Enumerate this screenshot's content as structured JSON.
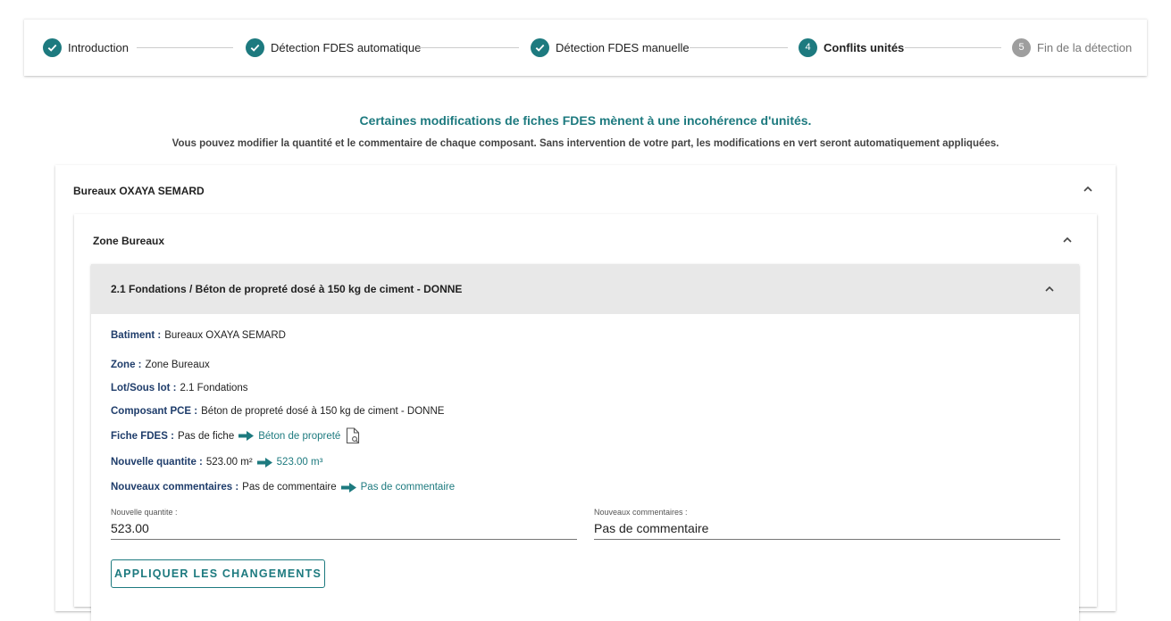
{
  "stepper": {
    "steps": [
      {
        "label": "Introduction",
        "state": "done"
      },
      {
        "label": "Détection FDES automatique",
        "state": "done"
      },
      {
        "label": "Détection FDES manuelle",
        "state": "done"
      },
      {
        "number": "4",
        "label": "Conflits unités",
        "state": "active"
      },
      {
        "number": "5",
        "label": "Fin de la détection",
        "state": "inactive"
      }
    ]
  },
  "intro": {
    "headline": "Certaines modifications de fiches FDES mènent à une incohérence d'unités.",
    "subtext": "Vous pouvez modifier la quantité et le commentaire de chaque composant. Sans intervention de votre part, les modifications en vert seront automatiquement appliquées."
  },
  "building": {
    "title": "Bureaux OXAYA SEMARD",
    "zone": {
      "title": "Zone Bureaux",
      "item": {
        "title": "2.1 Fondations / Béton de propreté dosé à 150 kg de ciment - DONNE",
        "batiment_label": "Batiment :",
        "batiment_value": "Bureaux OXAYA SEMARD",
        "zone_label": "Zone :",
        "zone_value": "Zone Bureaux",
        "lot_label": "Lot/Sous lot :",
        "lot_value": "2.1 Fondations",
        "composant_label": "Composant PCE :",
        "composant_value": "Béton de propreté dosé à 150 kg de ciment - DONNE",
        "fiche_label": "Fiche FDES :",
        "fiche_old": "Pas de fiche",
        "fiche_new": "Béton de propreté",
        "quantite_label": "Nouvelle quantite :",
        "quantite_old": "523.00 m²",
        "quantite_new": "523.00 m³",
        "commentaires_label": "Nouveaux commentaires :",
        "commentaires_old": "Pas de commentaire",
        "commentaires_new": "Pas de commentaire",
        "qty_field_label": "Nouvelle quantite :",
        "qty_field_value": "523.00",
        "comment_field_label": "Nouveaux commentaires :",
        "comment_field_value": "Pas de commentaire",
        "apply_button": "APPLIQUER LES CHANGEMENTS"
      }
    }
  },
  "colors": {
    "accent": "#1d7a7f",
    "label_blue": "#1f3d6b",
    "inactive": "#9e9e9e",
    "header_gray": "#e8e8e8"
  }
}
